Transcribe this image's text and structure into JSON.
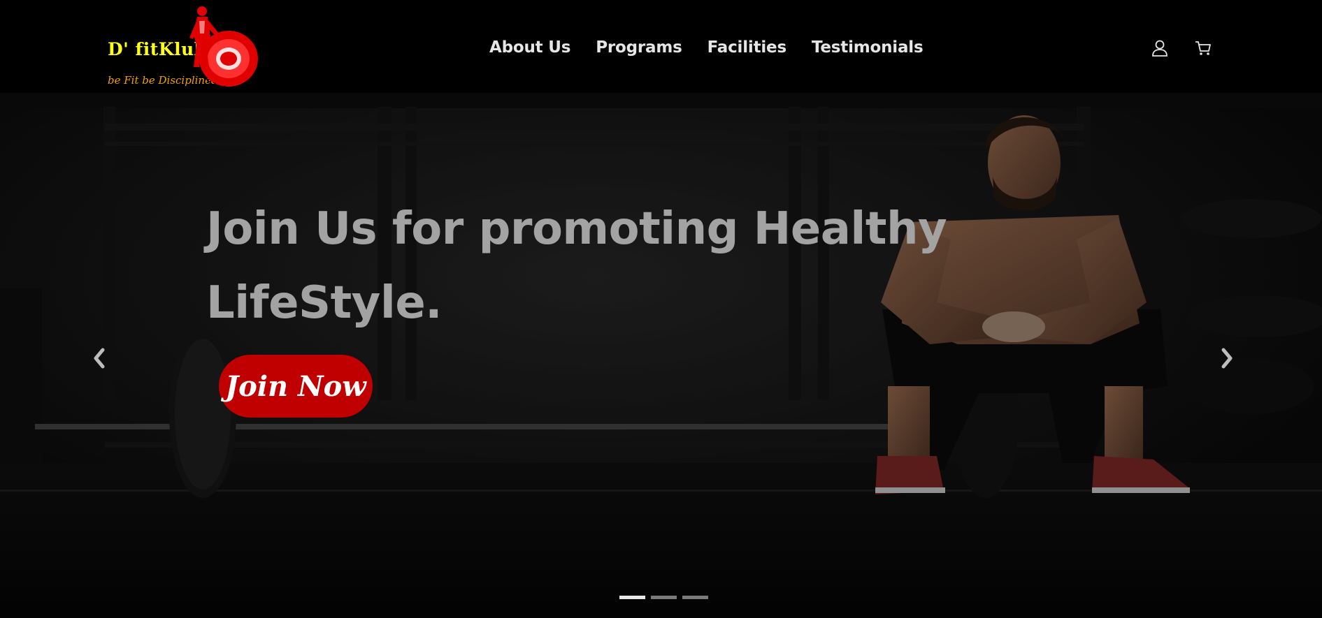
{
  "brand": {
    "name": "D' fitKlub",
    "tagline": "be Fit be Disciplined."
  },
  "nav": {
    "items": [
      {
        "label": "About Us"
      },
      {
        "label": "Programs"
      },
      {
        "label": "Facilities"
      },
      {
        "label": "Testimonials"
      }
    ]
  },
  "header_icons": [
    "user-icon",
    "cart-icon"
  ],
  "hero": {
    "title": "Join Us for promoting Healthy LifeStyle.",
    "cta_label": "Join Now",
    "prev_icon": "chevron-left-icon",
    "next_icon": "chevron-right-icon",
    "slides_count": 3,
    "active_slide": 1
  },
  "colors": {
    "header_bg": "#000000",
    "brand_yellow": "#ffff1a",
    "brand_orange": "#f5a000",
    "logo_red": "#e00000",
    "cta_red": "#c00000",
    "title_gray": "#a3a3a3",
    "nav_text": "#e6e6e6"
  }
}
